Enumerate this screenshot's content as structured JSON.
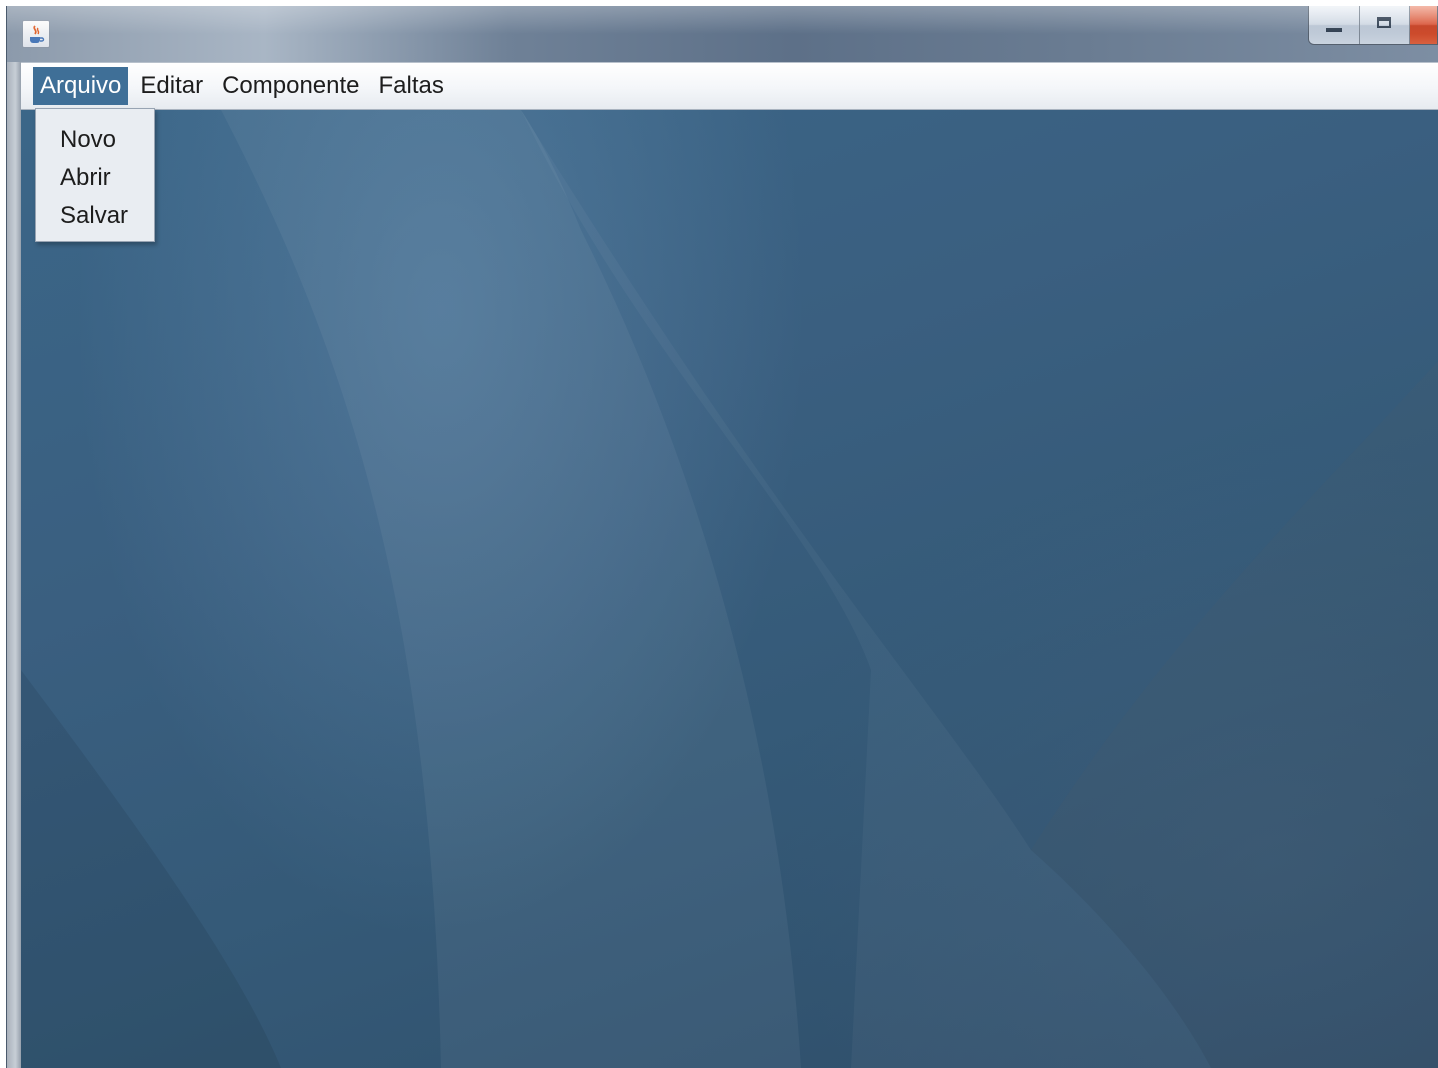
{
  "menubar": {
    "items": [
      {
        "label": "Arquivo",
        "active": true
      },
      {
        "label": "Editar"
      },
      {
        "label": "Componente"
      },
      {
        "label": "Faltas"
      }
    ]
  },
  "dropdown": {
    "items": [
      {
        "label": "Novo"
      },
      {
        "label": "Abrir"
      },
      {
        "label": "Salvar"
      }
    ]
  },
  "icons": {
    "app": "java-cup-icon",
    "minimize": "minimize-icon",
    "maximize": "maximize-icon",
    "close": "close-icon"
  },
  "colors": {
    "menu_highlight": "#3f6f97",
    "desktop": "#3a5f80",
    "close_button": "#c33a1c"
  }
}
